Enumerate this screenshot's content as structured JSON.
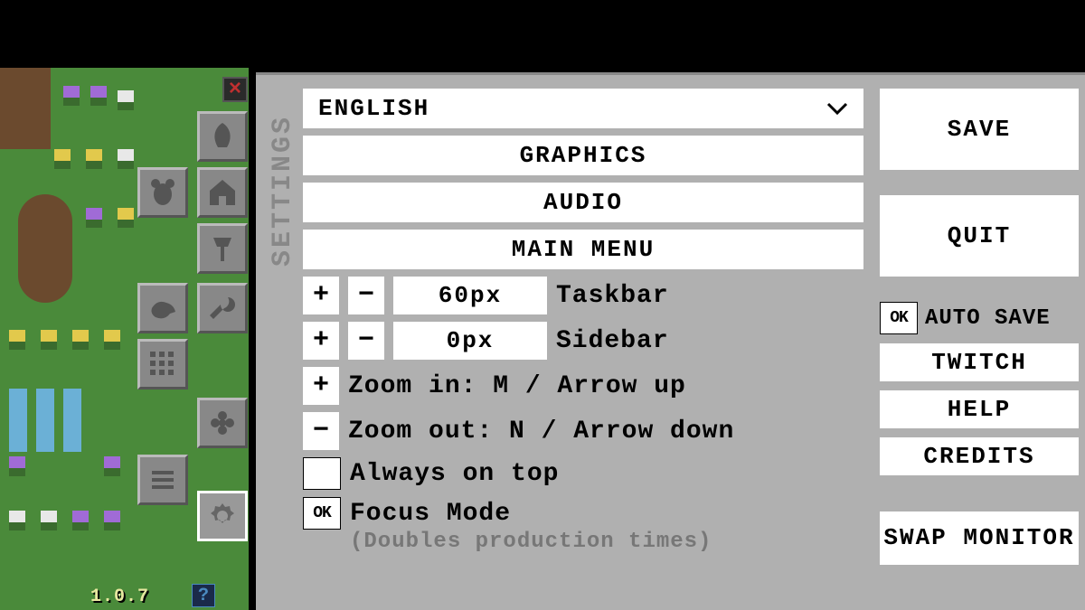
{
  "game": {
    "version": "1.0.7"
  },
  "settings": {
    "panel_title": "SETTINGS",
    "language": {
      "selected": "ENGLISH"
    },
    "sections": {
      "graphics": "GRAPHICS",
      "audio": "AUDIO",
      "main_menu": "MAIN MENU"
    },
    "taskbar": {
      "value": "60px",
      "label": "Taskbar"
    },
    "sidebar": {
      "value": "0px",
      "label": "Sidebar"
    },
    "zoom_in": {
      "symbol": "+",
      "label": "Zoom in: M / Arrow up"
    },
    "zoom_out": {
      "symbol": "−",
      "label": "Zoom out: N / Arrow down"
    },
    "always_on_top": {
      "label": "Always on top",
      "checked": false
    },
    "focus_mode": {
      "label": "Focus Mode",
      "sublabel": "(Doubles production times)",
      "checked": true,
      "ok_text": "OK"
    }
  },
  "actions": {
    "save": "SAVE",
    "quit": "QUIT",
    "auto_save": {
      "label": "AUTO SAVE",
      "checked": true,
      "ok_text": "OK"
    },
    "twitch": "TWITCH",
    "help": "HELP",
    "credits": "CREDITS",
    "swap_monitor": "SWAP MONITOR"
  },
  "icons": {
    "close": "×",
    "plus": "+",
    "minus": "−"
  }
}
